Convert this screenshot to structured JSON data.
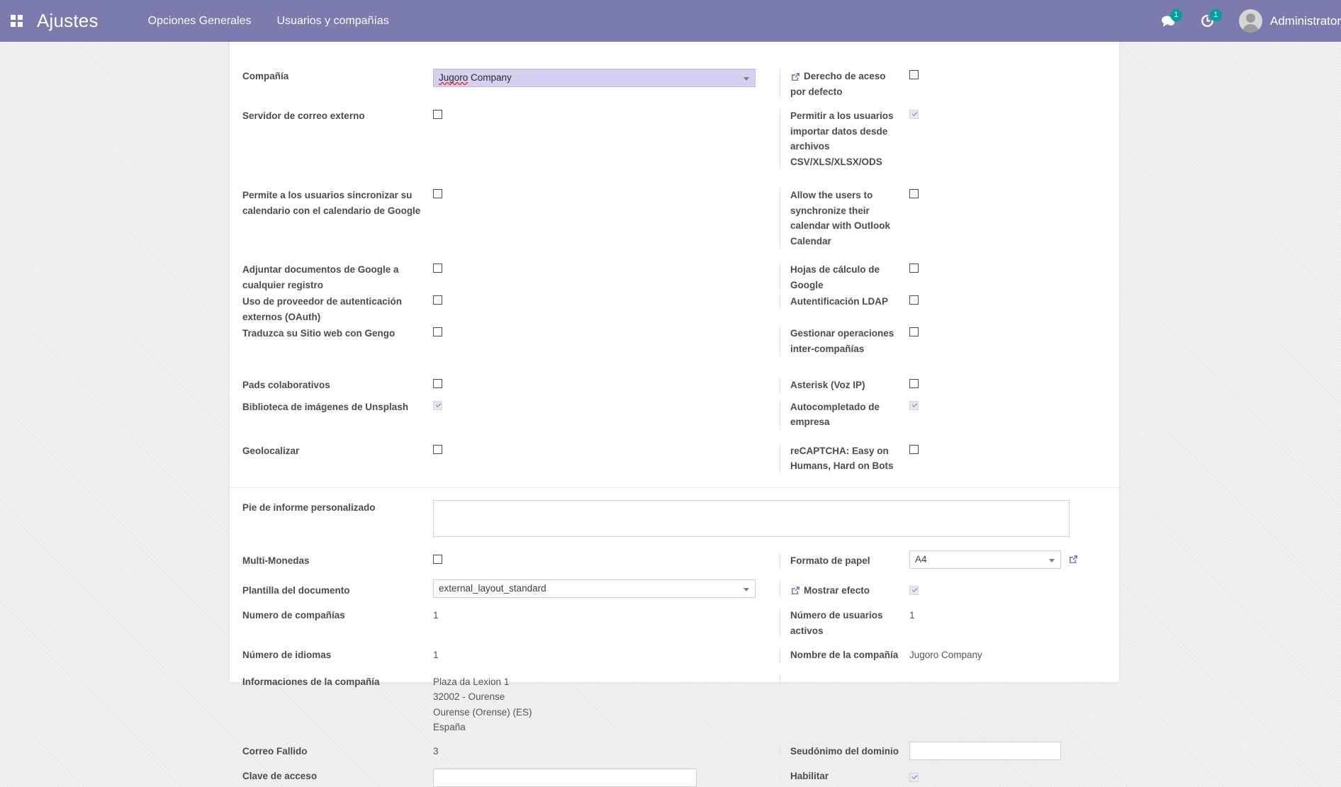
{
  "topbar": {
    "brand": "Ajustes",
    "apps_icon": "apps-grid-icon",
    "menu": [
      {
        "label": "Opciones Generales"
      },
      {
        "label": "Usuarios y compañías"
      }
    ],
    "messages_icon": "chat-bubble-icon",
    "messages_count": "1",
    "activities_icon": "clock-activity-icon",
    "activities_count": "1",
    "user_name": "Administrator",
    "accent": "#7c7bad",
    "badge_color": "#00a09d"
  },
  "form": {
    "company": {
      "label": "Compañía",
      "value_spell": "Jugoro",
      "value_rest": " Company"
    },
    "rows_left": [
      {
        "label": "Servidor de correo externo",
        "checked": false
      },
      {
        "label": "Permite a los usuarios sincronizar su calendario con el calendario de Google",
        "checked": false
      },
      {
        "label": "Adjuntar documentos de Google a cualquier registro",
        "checked": false
      },
      {
        "label": "Uso de proveedor de autenticación externos (OAuth)",
        "checked": false
      },
      {
        "label": "Traduzca su Sitio web con Gengo",
        "checked": false
      },
      {
        "label": "Pads colaborativos",
        "checked": false
      },
      {
        "label": "Biblioteca de imágenes de Unsplash",
        "checked": true
      },
      {
        "label": "Geolocalizar",
        "checked": false
      }
    ],
    "rows_right": [
      {
        "label": "Derecho de aceso por defecto",
        "checked": false,
        "icon": "external-link-icon"
      },
      {
        "label": "Permitir a los usuarios importar datos desde archivos CSV/XLS/XLSX/ODS",
        "checked": true
      },
      {
        "label": "Allow the users to synchronize their calendar with Outlook Calendar",
        "checked": false
      },
      {
        "label": "Hojas de cálculo de Google",
        "checked": false
      },
      {
        "label": "Autentificación LDAP",
        "checked": false
      },
      {
        "label": "Gestionar operaciones inter-compañías",
        "checked": false
      },
      {
        "label": "Asterisk (Voz IP)",
        "checked": false
      },
      {
        "label": "Autocompletado de empresa",
        "checked": true
      },
      {
        "label": "reCAPTCHA: Easy on Humans, Hard on Bots",
        "checked": false
      }
    ],
    "report_footer": {
      "label": "Pie de informe personalizado",
      "value": ""
    },
    "multi_currency": {
      "label": "Multi-Monedas",
      "checked": false
    },
    "paper_format": {
      "label": "Formato de papel",
      "value": "A4",
      "icon": "external-link-icon"
    },
    "doc_template": {
      "label": "Plantilla del documento",
      "value": "external_layout_standard",
      "icon": "external-link-icon"
    },
    "show_effect": {
      "label": "Mostrar efecto",
      "checked": true,
      "icon": "external-link-icon"
    },
    "num_companies": {
      "label": "Numero de compañías",
      "value": "1"
    },
    "num_active_users": {
      "label": "Número de usuarios activos",
      "value": "1"
    },
    "num_languages": {
      "label": "Número de idiomas",
      "value": "1"
    },
    "company_name": {
      "label": "Nombre de la compañía",
      "value": "Jugoro Company"
    },
    "company_info": {
      "label": "Informaciones de la compañía",
      "lines": [
        "Plaza da Lexion 1",
        "32002 - Ourense",
        "Ourense (Orense) (ES)",
        "España"
      ]
    },
    "failed_mail": {
      "label": "Correo Fallido",
      "value": "3"
    },
    "domain_alias": {
      "label": "Seudónimo del dominio",
      "value": ""
    },
    "access_key": {
      "label": "Clave de acceso",
      "value": ""
    },
    "enable": {
      "label": "Habilitar",
      "checked": true
    }
  }
}
